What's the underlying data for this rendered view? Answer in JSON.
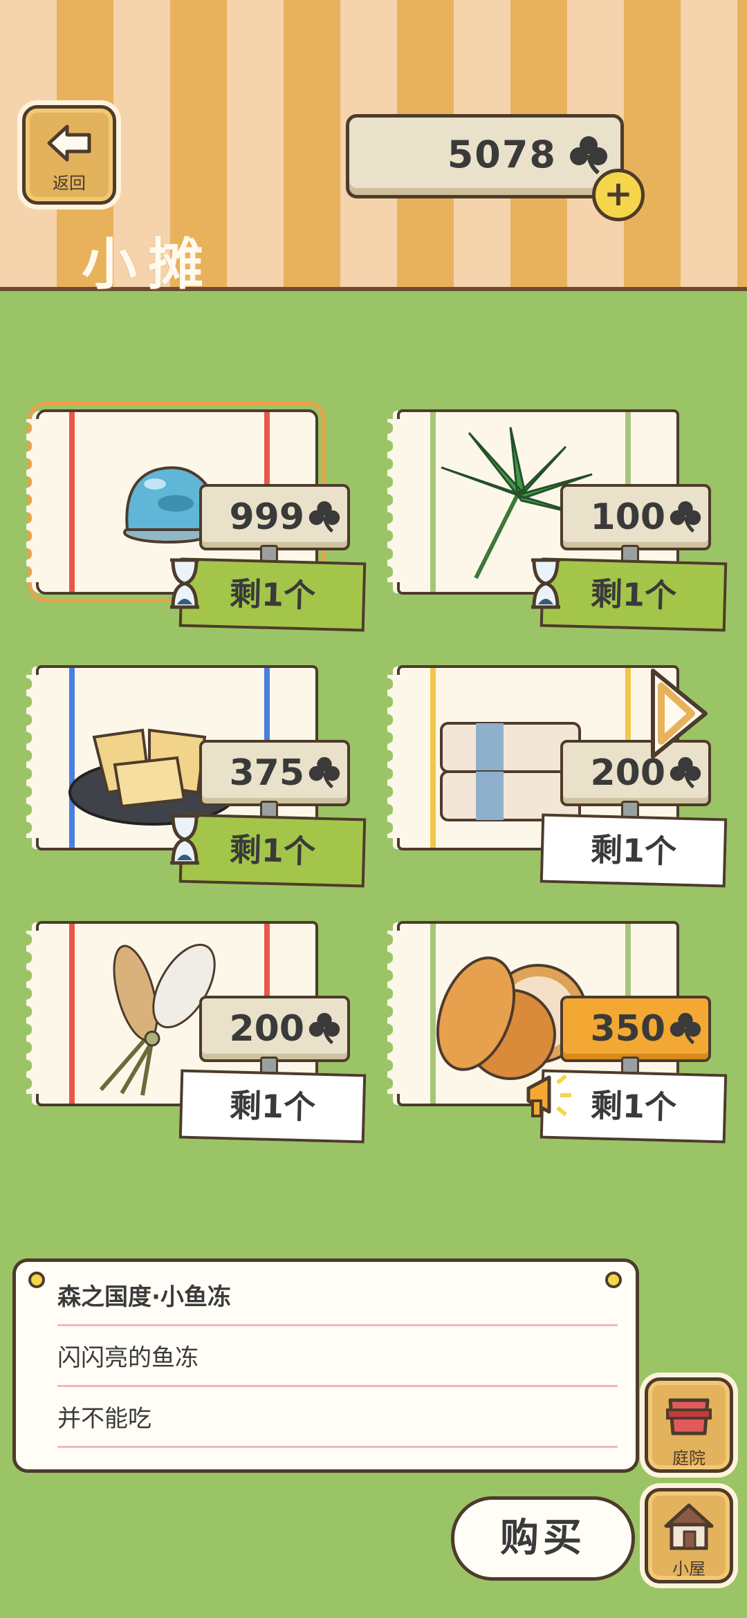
{
  "header": {
    "back_label": "返回",
    "coins": "5078",
    "title": "小摊"
  },
  "items": [
    {
      "price": "999",
      "stock": "剩1个",
      "timed": true,
      "selected": true,
      "item_icon": "blue-fish-jelly"
    },
    {
      "price": "100",
      "stock": "剩1个",
      "timed": true,
      "item_icon": "palm-leaf"
    },
    {
      "price": "375",
      "stock": "剩1个",
      "timed": true,
      "item_icon": "pizza-plate"
    },
    {
      "price": "200",
      "stock": "剩1个",
      "timed": false,
      "item_icon": "folded-towels"
    },
    {
      "price": "200",
      "stock": "剩1个",
      "timed": false,
      "item_icon": "dried-plants-bundle"
    },
    {
      "price": "350",
      "stock": "剩1个",
      "timed": false,
      "hot": true,
      "item_icon": "sesame-cookies"
    }
  ],
  "info": {
    "title": "森之国度·小鱼冻",
    "line1": "闪闪亮的鱼冻",
    "line2": "并不能吃"
  },
  "buttons": {
    "buy": "购买",
    "yard": "庭院",
    "house": "小屋"
  },
  "colors": {
    "background": "#9bc466",
    "header_stripe_a": "#f4d3ad",
    "header_stripe_b": "#e8b25c",
    "tag_green": "#a3c54a",
    "tag_hot": "#f2a833"
  }
}
